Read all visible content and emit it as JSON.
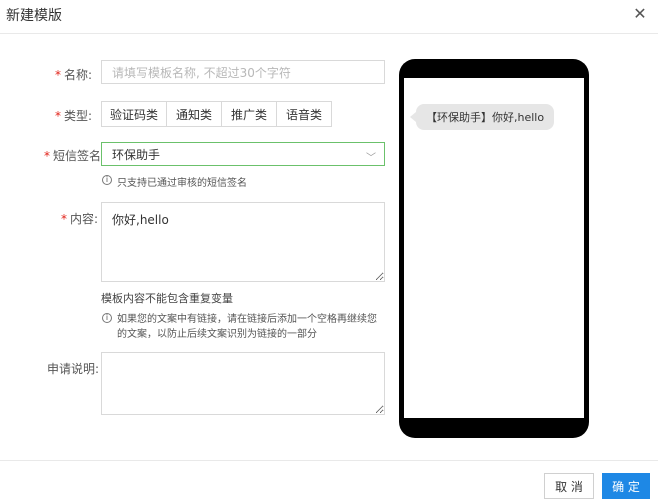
{
  "dialog": {
    "title": "新建模版",
    "close_icon": "close-icon"
  },
  "form": {
    "name": {
      "label": "名称:",
      "placeholder": "请填写模板名称, 不超过30个字符"
    },
    "type": {
      "label": "类型:",
      "options": [
        "验证码类",
        "通知类",
        "推广类",
        "语音类"
      ]
    },
    "signature": {
      "label": "短信签名:",
      "value": "环保助手",
      "hint": "只支持已通过审核的短信签名"
    },
    "content": {
      "label": "内容:",
      "value": "你好,hello",
      "note": "模板内容不能包含重复变量",
      "hint": "如果您的文案中有链接，请在链接后添加一个空格再继续您的文案，以防止后续文案识别为链接的一部分"
    },
    "description": {
      "label": "申请说明:",
      "value": ""
    }
  },
  "preview": {
    "message": "【环保助手】你好,hello"
  },
  "footer": {
    "cancel_label": "取 消",
    "ok_label": "确 定"
  },
  "colors": {
    "required": "#e2231a",
    "active_border": "#6bc16b",
    "primary": "#1e88e5"
  }
}
